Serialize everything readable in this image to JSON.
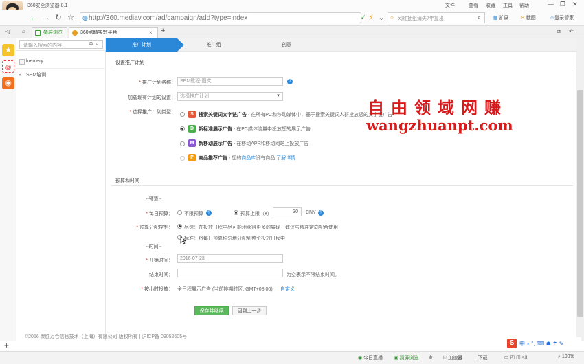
{
  "browser": {
    "title": "360安全浏览器 8.1",
    "title_controls": [
      "文件",
      "查看",
      "收藏",
      "工具",
      "帮助"
    ],
    "url": "http://360.mediav.com/ad/campaign/add?type=index",
    "search_placeholder": "网红抽组消失7年复出",
    "toolbar_right": [
      "扩展",
      "截图",
      "登录管家"
    ],
    "tabs": [
      {
        "label": "猜屏浏览"
      },
      {
        "label": "360点睛实效平台"
      }
    ],
    "new_tab": "+"
  },
  "sidebar": {
    "search_placeholder": "请输入搜索的内容",
    "items": [
      {
        "label": "luemery"
      },
      {
        "label": "SEM培训"
      }
    ]
  },
  "steps": [
    {
      "label": "推广计划",
      "active": true
    },
    {
      "label": "推广组",
      "active": false
    },
    {
      "label": "创意",
      "active": false
    }
  ],
  "form": {
    "section1_title": "设置推广计划",
    "plan_name_label": "推广计划名称：",
    "plan_name_value": "SEM教程-图文",
    "load_plan_label": "加载现有计划的设置：",
    "load_plan_value": "选择推广计划",
    "plan_type_label": "选择推广计划类型：",
    "plan_types": [
      {
        "title": "搜索关键词文字链广告",
        "desc": " - 在所有PC和移动媒体中，基于搜索关键词人群投放您的文字链广告",
        "selected": false,
        "color": "#e35a3a",
        "icon": "search-ad-icon",
        "glyph": "S"
      },
      {
        "title": "新标准展示广告",
        "desc": " - 在PC媒体流量中投放您的展示广告",
        "selected": true,
        "color": "#4cae4c",
        "icon": "display-ad-icon",
        "glyph": "D"
      },
      {
        "title": "新移动展示广告",
        "desc": " - 在移动APP和移动网站上投放广告",
        "selected": false,
        "color": "#8a5ad0",
        "icon": "mobile-ad-icon",
        "glyph": "M"
      },
      {
        "title": "商品推荐广告",
        "desc_before": " - 您的",
        "desc_link1": "商品库",
        "desc_mid": "没有商品 ",
        "desc_link2": "了解详情",
        "selected": false,
        "color": "#f39c12",
        "icon": "product-ad-icon",
        "glyph": "P"
      }
    ],
    "section2_title": "预算和时间",
    "budget_group": "--预算--",
    "daily_budget_label": "每日预算：",
    "no_budget_label": "不限预算",
    "budget_limit_label": "预算上限（¥）",
    "budget_value": "30",
    "budget_unit": "CNY",
    "budget_alloc_label": "预算分配控制：",
    "alloc_options": [
      {
        "text": "尽速：在投放日程中尽可能地获得更多的展现（建议与精准定向配合使用）",
        "selected": true
      },
      {
        "text": "标准：将每日预算均匀地分配到整个投放日程中",
        "selected": false
      }
    ],
    "time_group": "--时间--",
    "start_label": "开始时间：",
    "start_value": "2016-07-23",
    "end_label": "结束时间：",
    "end_hint": "为空表示不限结束时间。",
    "hourly_label": "按小时投放：",
    "hourly_value": "全日程展示广告 (当前排期时区: GMT+08:00)",
    "hourly_link": "自定义",
    "save_button": "保存并继续",
    "back_button": "回到上一步"
  },
  "footer": "©2016 聚胜万合信息技术（上海）有限公司 版权所有 | 沪ICP备 09052605号",
  "watermark": {
    "line1": "自由领域网赚",
    "line2": "wangzhuanpt.com"
  },
  "statusbar": {
    "items": [
      "今日直播",
      "猜屏浏览",
      "加速器",
      "下载"
    ],
    "zoom": "100%"
  },
  "colors": {
    "accent": "#2b88d8",
    "save_green": "#5cb85c",
    "watermark_red": "#d81a1a"
  }
}
